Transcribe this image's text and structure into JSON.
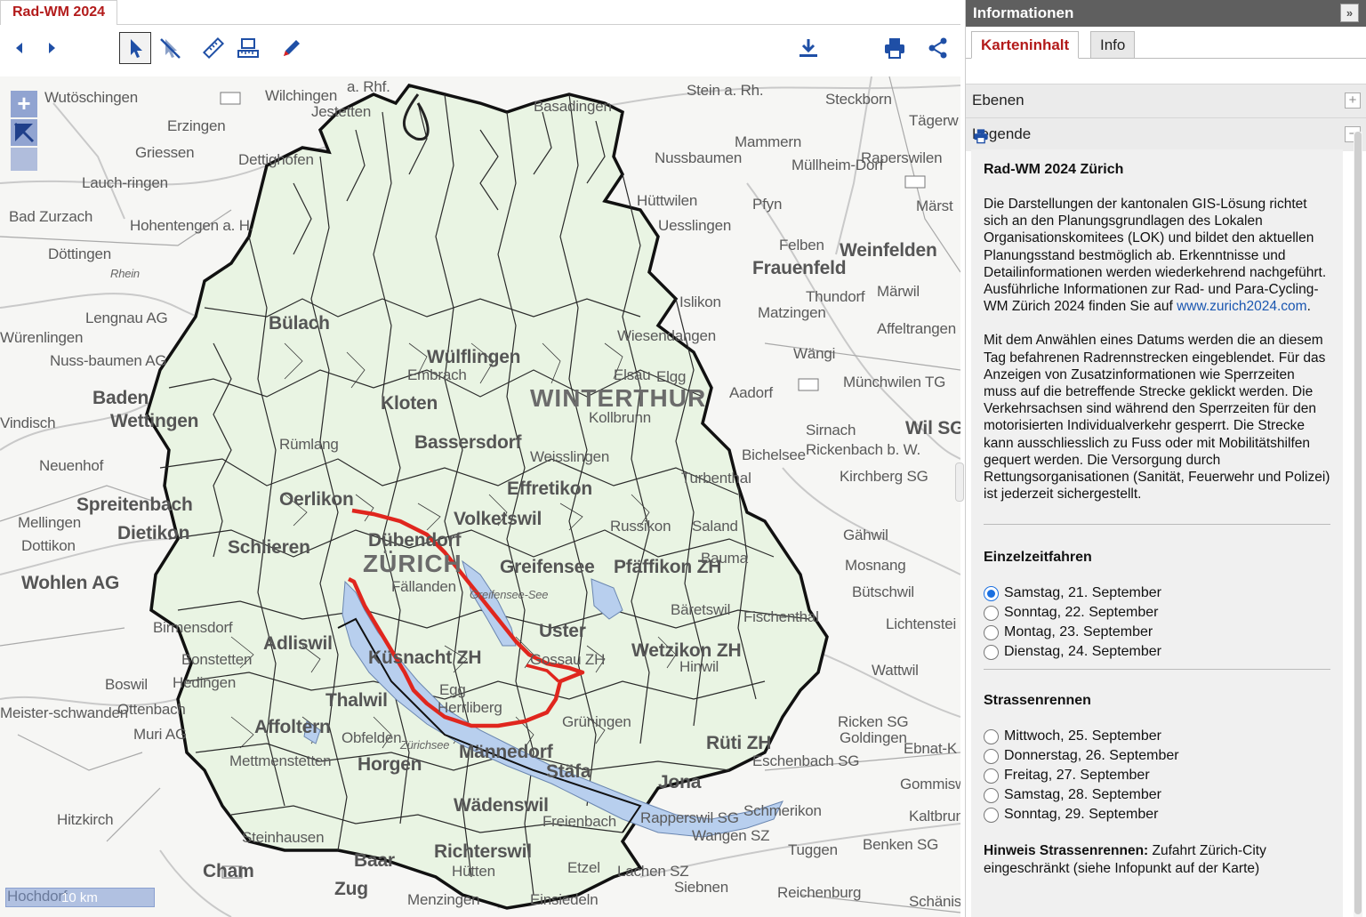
{
  "app": {
    "tab_title": "Rad-WM 2024"
  },
  "toolbar": {
    "buttons": [
      "back",
      "forward",
      "select",
      "clear-select",
      "measure",
      "measure-area",
      "draw",
      "download",
      "print",
      "share"
    ]
  },
  "map": {
    "zoom_in": "+",
    "scale_label": "10 km",
    "places": [
      "Wutöschingen",
      "Wilchingen",
      "a. Rhf.",
      "Stein a. Rh.",
      "Steckborn",
      "Erzingen",
      "Jestetten",
      "Basadingen",
      "Tägerw",
      "Griessen",
      "Dettighofen",
      "Mammern",
      "Müllheim-Dorf",
      "Lauch-ringen",
      "Nussbaumen",
      "Raperswilen",
      "Bad Zurzach",
      "Hohentengen a. H.",
      "Hüttwilen",
      "Märst",
      "Döttingen",
      "Uesslingen",
      "Pfyn",
      "Weinfelden",
      "Felben",
      "Rhein",
      "Frauenfeld",
      "Lengnau AG",
      "Würenlingen",
      "Matzingen",
      "Thundorf",
      "Märwil",
      "Islikon",
      "Nuss-baumen AG",
      "Affeltrangen",
      "Wiesendangen",
      "Wängi",
      "Baden",
      "Wettingen",
      "Münchwilen TG",
      "WINTERTHUR",
      "Elgg",
      "Aadorf",
      "Elsau",
      "Bülach",
      "Embrach",
      "Kloten",
      "Wülflingen",
      "Kollbrunn",
      "Vindisch",
      "Neuenhof",
      "Rümlang",
      "Bassersdorf",
      "Wil SG",
      "Sirnach",
      "Rickenbach b. W.",
      "Weisslingen",
      "Bichelsee",
      "Turbenthal",
      "Kirchberg SG",
      "Spreitenbach",
      "Oerlikon",
      "Effretikon",
      "Mellingen",
      "Dietikon",
      "Volketswil",
      "Dottikon",
      "Schlieren",
      "Dübendorf",
      "Russikon",
      "Saland",
      "Gähwil",
      "ZÜRICH",
      "Greifensee",
      "Pfäffikon ZH",
      "Bauma",
      "Mosnang",
      "Wohlen AG",
      "Fällanden",
      "Bäretswil",
      "Bütschwil",
      "Birmensdorf",
      "Uster",
      "Fischenthal",
      "Lichtenstei",
      "Adliswil",
      "Küsnacht ZH",
      "Wetzikon ZH",
      "Hinwil",
      "Wattwil",
      "Bonstetten",
      "Egg",
      "Boswil",
      "Hedingen",
      "Herrliberg",
      "Gossau ZH",
      "Ottenbach",
      "Thalwil",
      "Meister-schwanden",
      "Affoltern",
      "Muri AG",
      "Ricken SG",
      "Goldingen",
      "Männedorf",
      "Grüningen",
      "Rüti ZH",
      "Ebnat-K",
      "Obfelden",
      "Mettmenstetten",
      "Horgen",
      "Stäfa",
      "Eschenbach SG",
      "Jona",
      "Gommiswald",
      "Hitzkirch",
      "Wädenswil",
      "Rapperswil SG",
      "Schmerikon",
      "Kaltbrunn",
      "Richterswil",
      "Freienbach",
      "Wangen SZ",
      "Steinhausen",
      "Benken SG",
      "Cham",
      "Baar",
      "Tuggen",
      "Etzel",
      "Lachen SZ",
      "Siebnen",
      "Reichenburg",
      "Hütten",
      "Einsiedeln",
      "Menzingen",
      "Zug",
      "Hochdorf",
      "Schänis",
      "Zürichsee",
      "Greifensee-See"
    ]
  },
  "panel": {
    "title": "Informationen",
    "collapse_icon": "»",
    "tabs": [
      "Karteninhalt",
      "Info"
    ],
    "sections": [
      {
        "label": "Ebenen",
        "toggle": "+"
      },
      {
        "label": "Legende",
        "toggle": "−"
      }
    ],
    "legend": {
      "heading": "Rad-WM 2024 Zürich",
      "para1_pre": "Die Darstellungen der kantonalen GIS-Lösung richtet sich an den Planungsgrundlagen des Lokalen Organisationskomitees (LOK) und bildet den aktuellen Planungsstand bestmöglich ab. Erkenntnisse und Detailinformationen werden wiederkehrend nachgeführt. Ausführliche Informationen zur Rad- und Para-Cycling-WM Zürich 2024 finden Sie auf ",
      "para1_link": "www.zurich2024.com",
      "para1_post": ".",
      "para2": "Mit dem Anwählen eines Datums werden die an diesem Tag befahrenen Radrennstrecken eingeblendet. Für das Anzeigen von Zusatzinformationen wie Sperrzeiten muss auf die betreffende Strecke geklickt werden. Die Verkehrsachsen sind während den Sperrzeiten für den motorisierten Individualverkehr gesperrt. Die Strecke kann ausschliesslich zu Fuss oder mit Mobilitätshilfen gequert werden. Die Versorgung durch Rettungsorganisationen (Sanität, Feuerwehr und Polizei) ist jederzeit sichergestellt.",
      "group1_title": "Einzelzeitfahren",
      "group1_options": [
        "Samstag, 21. September",
        "Sonntag, 22. September",
        "Montag, 23. September",
        "Dienstag, 24. September"
      ],
      "group1_selected": 0,
      "group2_title": "Strassenrennen",
      "group2_options": [
        "Mittwoch, 25. September",
        "Donnerstag, 26. September",
        "Freitag, 27. September",
        "Samstag, 28. September",
        "Sonntag, 29. September"
      ],
      "hint_label": "Hinweis Strassenrennen:",
      "hint_text": " Zufahrt Zürich-City eingeschränkt (siehe Infopunkt auf der Karte)"
    }
  },
  "colors": {
    "accent": "#b31b1b",
    "route": "#e0261e",
    "lake": "#b8cfee",
    "canton_fill": "#e9f4e3",
    "link": "#1a56b0"
  }
}
